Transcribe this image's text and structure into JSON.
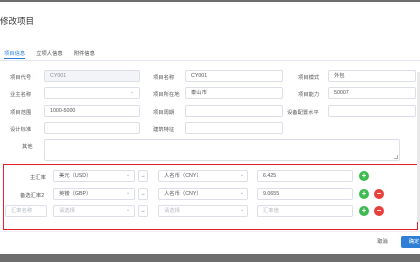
{
  "dialog": {
    "title": "修改项目"
  },
  "tabs": [
    "项目信息",
    "立项人信息",
    "附件信息"
  ],
  "form": {
    "project_code": {
      "label": "项目代号",
      "value": "CY001"
    },
    "project_name": {
      "label": "项目名称",
      "value": "CY001"
    },
    "project_mode": {
      "label": "项目模式",
      "value": "外包"
    },
    "owner_name": {
      "label": "业主名称",
      "value": ""
    },
    "location": {
      "label": "项目所在地",
      "value": "泰山市"
    },
    "capacity": {
      "label": "项目能力",
      "value": "50007"
    },
    "range": {
      "label": "项目范围",
      "value": "1000-5000"
    },
    "term": {
      "label": "项目周期",
      "value": ""
    },
    "equip_level": {
      "label": "设备配置水平",
      "value": ""
    },
    "design_std": {
      "label": "设计标准",
      "value": ""
    },
    "building_feat": {
      "label": "建筑特征",
      "value": ""
    },
    "other": {
      "label": "其他",
      "value": ""
    }
  },
  "exchange": {
    "rows": [
      {
        "label": "主汇率",
        "from": "美元（USD）",
        "to": "人名币（CNY）",
        "rate": "6.425"
      },
      {
        "label": "备选汇率2",
        "from": "英镑（GBP）",
        "to": "人名币（CNY）",
        "rate": "9.0655"
      }
    ],
    "placeholder_row": {
      "label": "汇率名称",
      "from": "请选择",
      "to": "请选择",
      "rate": "汇率值"
    },
    "arrow": "→",
    "plus": "+",
    "minus": "−"
  },
  "footer": {
    "cancel": "取消",
    "ok": "确定"
  }
}
